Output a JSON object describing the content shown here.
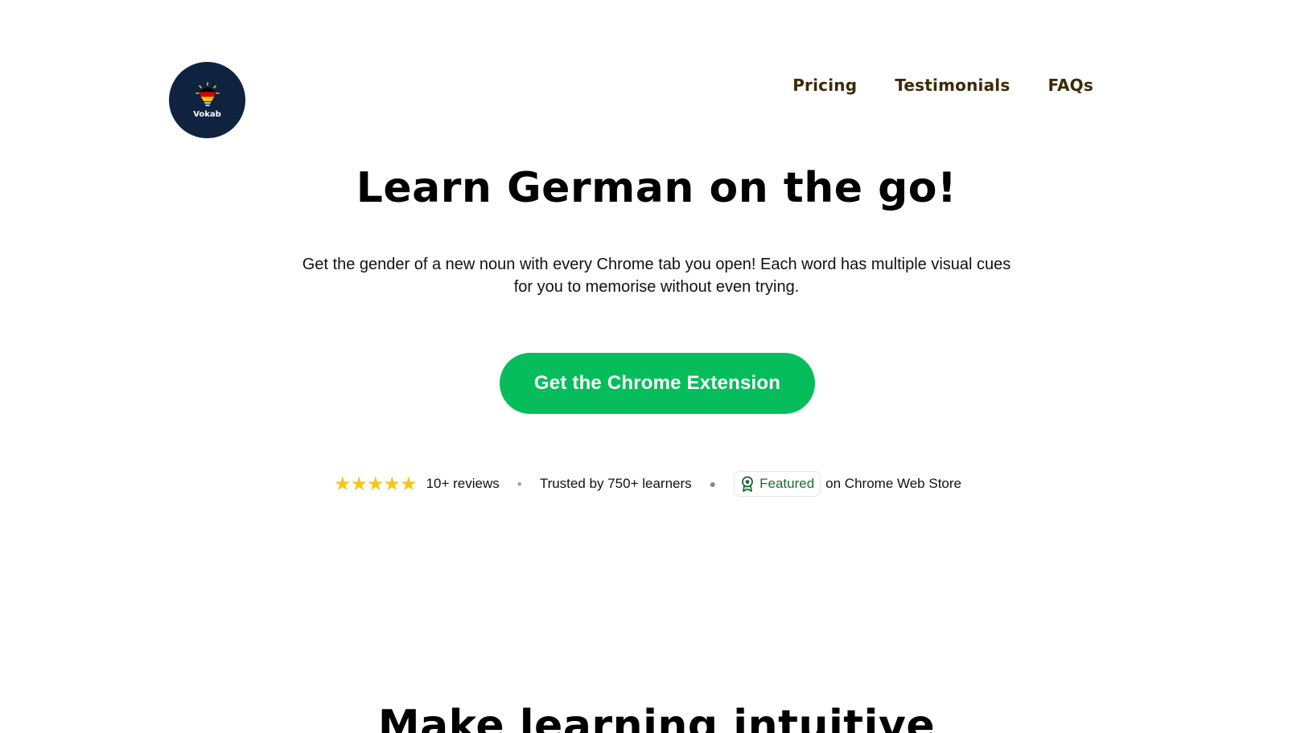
{
  "header": {
    "logo_text": "Vokab",
    "nav": [
      {
        "label": "Pricing"
      },
      {
        "label": "Testimonials"
      },
      {
        "label": "FAQs"
      }
    ]
  },
  "hero": {
    "title": "Learn German on the go!",
    "subtitle": "Get the gender of a new noun with every Chrome tab you open! Each word has multiple visual cues for you to memorise without even trying.",
    "cta_label": "Get the Chrome Extension"
  },
  "trust": {
    "stars": "★★★★★",
    "rating": 5,
    "reviews": "10+ reviews",
    "learners": "Trusted by 750+ learners",
    "featured_label": "Featured",
    "store_text": "on Chrome Web Store"
  },
  "section2": {
    "title": "Make learning intuitive"
  },
  "colors": {
    "logo_bg": "#0f2340",
    "nav_text": "#3b2a08",
    "cta_bg": "#05bd5b",
    "stars": "#f5c518",
    "featured_text": "#1b6b2f"
  },
  "icons": {
    "logo": "lightbulb-german-flag-icon",
    "featured": "award-badge-icon"
  }
}
